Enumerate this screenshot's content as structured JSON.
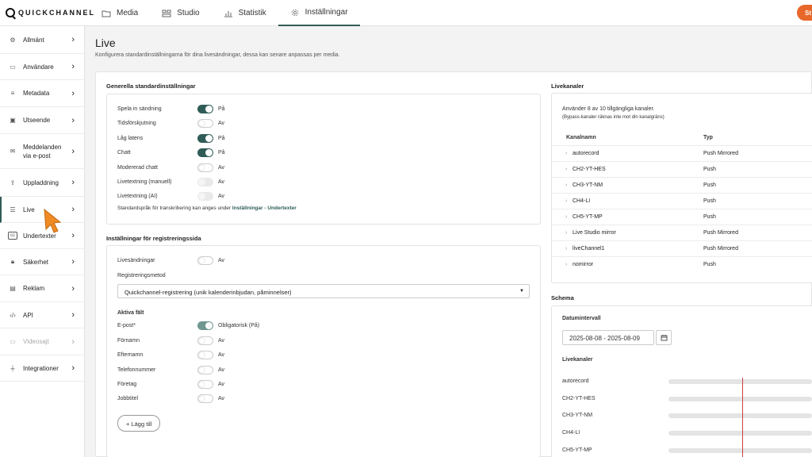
{
  "app": {
    "logo_text": "QUICKCHANNEL",
    "top_button": "St"
  },
  "nav": [
    {
      "label": "Media",
      "icon": "folder-icon"
    },
    {
      "label": "Studio",
      "icon": "studio-icon"
    },
    {
      "label": "Statistik",
      "icon": "chart-icon"
    },
    {
      "label": "Inställningar",
      "icon": "gear-icon",
      "active": true
    }
  ],
  "sidebar": [
    {
      "label": "Allmänt",
      "icon": "gear-icon"
    },
    {
      "label": "Användare",
      "icon": "users-icon"
    },
    {
      "label": "Metadata",
      "icon": "list-icon"
    },
    {
      "label": "Utseende",
      "icon": "image-icon"
    },
    {
      "label": "Meddelanden",
      "label2": "via e-post",
      "icon": "mail-icon"
    },
    {
      "label": "Uppladdning",
      "icon": "upload-icon"
    },
    {
      "label": "Live",
      "icon": "live-icon",
      "active": true
    },
    {
      "label": "Undertexter",
      "icon": "cc-icon"
    },
    {
      "label": "Säkerhet",
      "icon": "lock-icon"
    },
    {
      "label": "Reklam",
      "icon": "ad-icon"
    },
    {
      "label": "API",
      "icon": "code-icon"
    },
    {
      "label": "Videosajt",
      "icon": "monitor-icon",
      "disabled": true
    },
    {
      "label": "Integrationer",
      "icon": "plug-icon"
    }
  ],
  "page": {
    "title": "Live",
    "subtitle": "Konfigurera standardinställningarna för dina livesändningar, dessa kan senare anpassas per media."
  },
  "general": {
    "heading": "Generella standardinställningar",
    "rows": [
      {
        "label": "Spela in sändning",
        "state": "on",
        "value": "På"
      },
      {
        "label": "Tidsförskjutning",
        "state": "off",
        "value": "Av"
      },
      {
        "label": "Låg latens",
        "state": "on",
        "value": "På"
      },
      {
        "label": "Chatt",
        "state": "on",
        "value": "På"
      },
      {
        "label": "Modererad chatt",
        "state": "off",
        "value": "Av"
      },
      {
        "label": "Livetextning (manuell)",
        "state": "dis",
        "value": "Av"
      },
      {
        "label": "Livetextning (AI)",
        "state": "dis",
        "value": "Av"
      }
    ],
    "note": "Standardspråk för transkribering kan anges under",
    "note_link": "Inställningar - Undertexter"
  },
  "registration": {
    "heading": "Inställningar för registreringssida",
    "live_label": "Livesändningar",
    "live_value": "Av",
    "method_label": "Registreringsmetod",
    "method_value": "Quickchannel-registrering (unik kalenderinbjudan, påminnelser)",
    "fields_heading": "Aktiva fält",
    "fields": [
      {
        "label": "E-post*",
        "state": "onlite",
        "value": "Obligatorisk (På)"
      },
      {
        "label": "Förnamn",
        "state": "off",
        "value": "Av"
      },
      {
        "label": "Efternamn",
        "state": "off",
        "value": "Av"
      },
      {
        "label": "Telefonnummer",
        "state": "off",
        "value": "Av"
      },
      {
        "label": "Företag",
        "state": "off",
        "value": "Av"
      },
      {
        "label": "Jobbtitel",
        "state": "off",
        "value": "Av"
      }
    ],
    "add_button": "+ Lägg till"
  },
  "livechannels": {
    "heading": "Livekanaler",
    "usage": "Använder 8 av 10 tillgängliga kanaler.",
    "usage_note": "(Bypass-kanaler räknas inte mot din kanalgräns)",
    "col_name": "Kanalnamn",
    "col_type": "Typ",
    "rows": [
      {
        "name": "autorecord",
        "type": "Push Mirrored"
      },
      {
        "name": "CH2-YT-HES",
        "type": "Push"
      },
      {
        "name": "CH3-YT-NM",
        "type": "Push"
      },
      {
        "name": "CH4-LI",
        "type": "Push"
      },
      {
        "name": "CH5-YT-MP",
        "type": "Push"
      },
      {
        "name": "Live Studio mirror",
        "type": "Push Mirrored"
      },
      {
        "name": "liveChannel1",
        "type": "Push Mirrored"
      },
      {
        "name": "nomirror",
        "type": "Push"
      }
    ]
  },
  "schema": {
    "heading": "Schema",
    "date_label": "Datumintervall",
    "date_value": "2025-08-08 - 2025-08-09",
    "channels_label": "Livekanaler",
    "channels": [
      "autorecord",
      "CH2-YT-HES",
      "CH3-YT-NM",
      "CH4-LI",
      "CH5-YT-MP"
    ]
  }
}
